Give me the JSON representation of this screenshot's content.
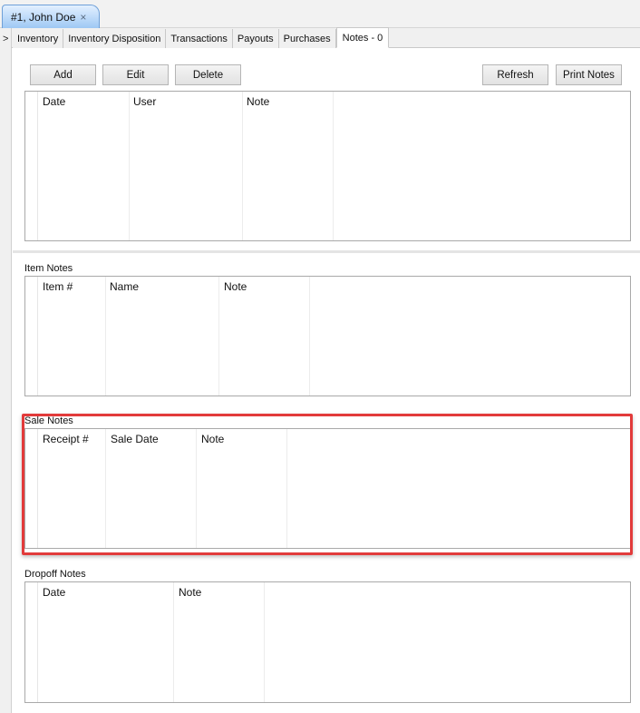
{
  "document_tab": {
    "title": "#1, John Doe",
    "close_glyph": "×"
  },
  "expander": {
    "glyph": ">"
  },
  "subtabs": [
    {
      "label": "Inventory"
    },
    {
      "label": "Inventory Disposition"
    },
    {
      "label": "Transactions"
    },
    {
      "label": "Payouts"
    },
    {
      "label": "Purchases"
    },
    {
      "label": "Notes - 0"
    }
  ],
  "toolbar": {
    "add": "Add",
    "edit": "Edit",
    "delete": "Delete",
    "refresh": "Refresh",
    "print_notes": "Print Notes"
  },
  "notes_grid": {
    "columns": [
      "Date",
      "User",
      "Note"
    ]
  },
  "item_notes": {
    "label": "Item Notes",
    "columns": [
      "Item #",
      "Name",
      "Note"
    ]
  },
  "sale_notes": {
    "label": "Sale Notes",
    "columns": [
      "Receipt #",
      "Sale Date",
      "Note"
    ]
  },
  "dropoff_notes": {
    "label": "Dropoff Notes",
    "columns": [
      "Date",
      "Note"
    ]
  },
  "colors": {
    "highlight": "#e23b3b",
    "tab_accent": "#9ec8f4"
  }
}
